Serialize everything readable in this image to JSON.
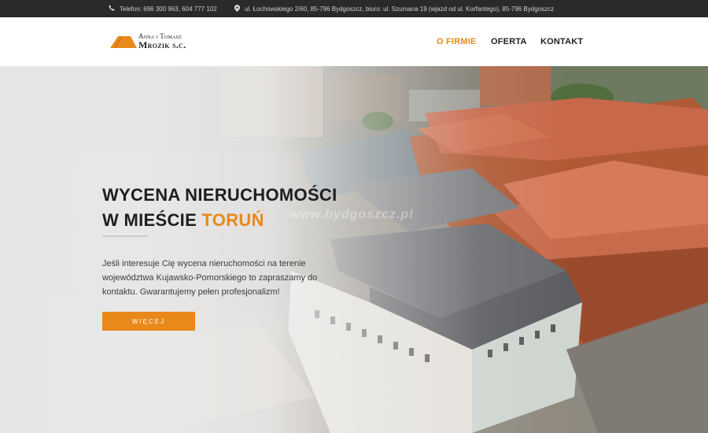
{
  "topbar": {
    "phone_icon": "phone-icon",
    "phone_text": "Telefon: 696 300 963, 604 777 102",
    "address_icon": "map-marker-icon",
    "address_text": "ul. Łochowskiego 2/60, 85-796 Bydgoszcz, biuro: ul. Szumana 19 (wjazd od ul. Korfantego), 85-796 Bydgoszcz"
  },
  "logo": {
    "line1": "Anna i Tomasz",
    "line2": "Mrozik s.c."
  },
  "nav": {
    "items": [
      {
        "label": "O FIRMIE",
        "active": true
      },
      {
        "label": "OFERTA",
        "active": false
      },
      {
        "label": "KONTAKT",
        "active": false
      }
    ]
  },
  "hero": {
    "title_line1": "WYCENA NIERUCHOMOŚCI",
    "title_line2_prefix": "W MIEŚCIE",
    "title_line2_highlight": "TORUŃ",
    "description": "Jeśli interesuje Cię wycena nieruchomości na terenie województwa Kujawsko-Pomorskiego to zapraszamy do kontaktu. Gwarantujemy pełen profesjonalizm!",
    "button_label": "WIĘCEJ",
    "watermark": "www.bydgoszcz.pl"
  },
  "colors": {
    "accent": "#e8891a",
    "topbar_bg": "#2a2a2a",
    "text_dark": "#1e1e1e"
  }
}
